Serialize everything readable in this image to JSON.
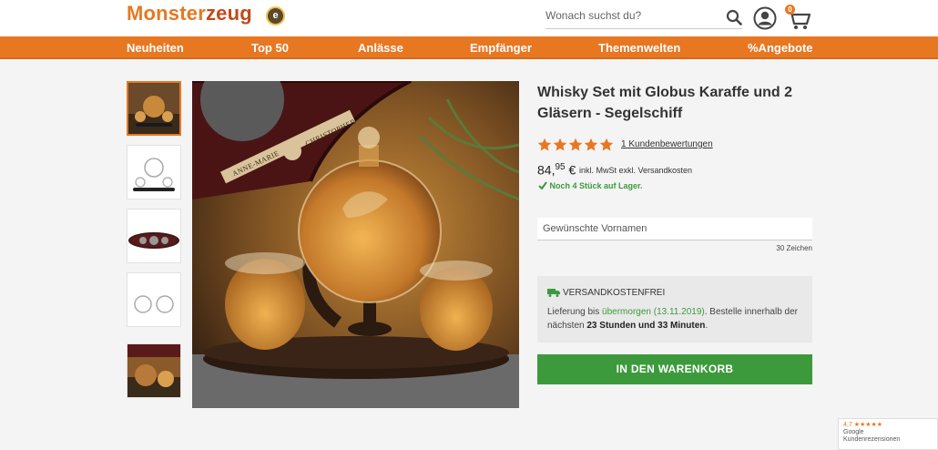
{
  "header": {
    "logo_part1": "Monster",
    "logo_part2": "zeug",
    "trust_badge": "e",
    "search_placeholder": "Wonach suchst du?",
    "cart_count": "0"
  },
  "nav": {
    "items": [
      "Neuheiten",
      "Top 50",
      "Anlässe",
      "Empfänger",
      "Themenwelten",
      "%Angebote"
    ]
  },
  "product": {
    "title": "Whisky Set mit Globus Karaffe und 2 Gläsern - Segelschiff",
    "rating": 5,
    "reviews_link": "1 Kundenbewertungen",
    "price_main": "84,",
    "price_cents": "95",
    "currency": "€",
    "price_note": "inkl. MwSt exkl. Versandkosten",
    "stock": "Noch 4 Stück auf Lager.",
    "names_placeholder": "Gewünschte Vornamen",
    "char_limit": "30 Zeichen",
    "image_engraving": [
      "ANNE-MARIE",
      "CHRISTOPHER"
    ]
  },
  "shipping": {
    "title": "VERSANDKOSTENFREI",
    "line_prefix": "Lieferung bis ",
    "date_highlight": "übermorgen (13.11.2019)",
    "line_suffix": ". Bestelle innerhalb der nächsten ",
    "time_left": "23 Stunden und 33 Minuten",
    "end": "."
  },
  "cart_button": "IN DEN WARENKORB",
  "google_badge": {
    "score": "4,7",
    "stars": "★★★★★",
    "line1": "Google",
    "line2": "Kundenrezensionen"
  },
  "colors": {
    "brand_orange": "#e87722",
    "success_green": "#3c9a3c"
  },
  "icons": [
    "search-icon",
    "user-icon",
    "cart-icon",
    "star-icon",
    "check-icon",
    "truck-icon"
  ]
}
